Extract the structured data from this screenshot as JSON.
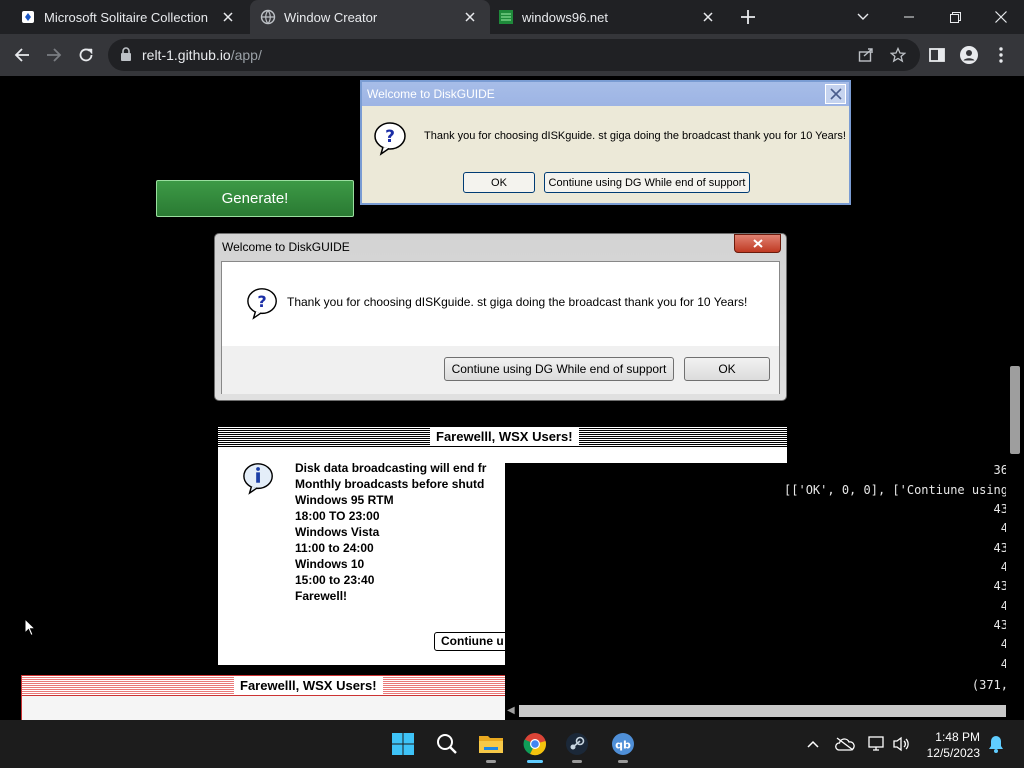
{
  "tabs": [
    {
      "title": "Microsoft Solitaire Collection",
      "icon": "solitaire-icon"
    },
    {
      "title": "Window Creator",
      "icon": "globe-icon"
    },
    {
      "title": "windows96.net",
      "icon": "windows96-icon"
    }
  ],
  "address_bar": {
    "domain": "relt-1.github.io",
    "path": "/app/"
  },
  "page": {
    "generate_label": "Generate!",
    "xp_dialog": {
      "title": "Welcome to DiskGUIDE",
      "message": "Thank you for choosing dISKguide. st giga doing the broadcast thank you for 10 Years!",
      "ok_label": "OK",
      "continue_label": "Contiune using DG While end of support"
    },
    "win7_dialog": {
      "title": "Welcome to DiskGUIDE",
      "message": "Thank you for choosing dISKguide. st giga doing the broadcast thank you for 10 Years!",
      "continue_label": "Contiune using DG While end of support",
      "ok_label": "OK"
    },
    "mac_dialog": {
      "title": "Farewelll, WSX Users!",
      "lines": [
        "Disk data broadcasting will end fr",
        "Monthly broadcasts before shutd",
        "Windows 95 RTM",
        "18:00 TO 23:00",
        "Windows Vista",
        "11:00 to 24:00",
        "Windows 10",
        "15:00 to 23:40",
        "Farewell!"
      ],
      "button_label": "Contiune u"
    },
    "mac_dialog_2": {
      "title": "Farewelll, WSX Users!"
    },
    "console_lines": [
      "36",
      "[['OK', 0, 0], ['Contiune using",
      "43",
      "4",
      "43",
      "4",
      "43",
      "4",
      "43",
      "4",
      "4",
      "(371,"
    ]
  },
  "taskbar": {
    "apps": [
      "start-icon",
      "search-icon",
      "file-explorer-icon",
      "chrome-icon",
      "steam-icon",
      "qbittorrent-icon"
    ],
    "time": "1:48 PM",
    "date": "12/5/2023"
  }
}
